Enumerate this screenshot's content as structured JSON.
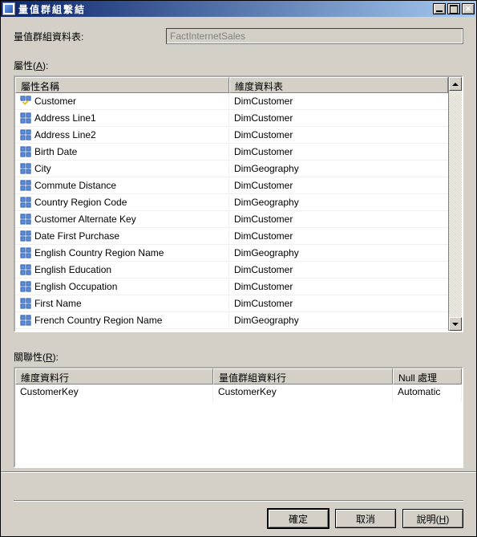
{
  "window": {
    "title": "量值群組繫結"
  },
  "measure_group": {
    "label": "量值群組資料表:",
    "value": "FactInternetSales"
  },
  "attributes": {
    "label_prefix": "屬性(",
    "label_key": "A",
    "label_suffix": "):",
    "col_name": "屬性名稱",
    "col_dim": "維度資料表",
    "rows": [
      {
        "icon": "key",
        "name": "Customer",
        "dim": "DimCustomer"
      },
      {
        "icon": "attr",
        "name": "Address Line1",
        "dim": "DimCustomer"
      },
      {
        "icon": "attr",
        "name": "Address Line2",
        "dim": "DimCustomer"
      },
      {
        "icon": "attr",
        "name": "Birth Date",
        "dim": "DimCustomer"
      },
      {
        "icon": "attr",
        "name": "City",
        "dim": "DimGeography"
      },
      {
        "icon": "attr",
        "name": "Commute Distance",
        "dim": "DimCustomer"
      },
      {
        "icon": "attr",
        "name": "Country Region Code",
        "dim": "DimGeography"
      },
      {
        "icon": "attr",
        "name": "Customer Alternate Key",
        "dim": "DimCustomer"
      },
      {
        "icon": "attr",
        "name": "Date First Purchase",
        "dim": "DimCustomer"
      },
      {
        "icon": "attr",
        "name": "English Country Region Name",
        "dim": "DimGeography"
      },
      {
        "icon": "attr",
        "name": "English Education",
        "dim": "DimCustomer"
      },
      {
        "icon": "attr",
        "name": "English Occupation",
        "dim": "DimCustomer"
      },
      {
        "icon": "attr",
        "name": "First Name",
        "dim": "DimCustomer"
      },
      {
        "icon": "attr",
        "name": "French Country Region Name",
        "dim": "DimGeography"
      }
    ]
  },
  "relationship": {
    "label_prefix": "關聯性(",
    "label_key": "R",
    "label_suffix": "):",
    "col_dim": "維度資料行",
    "col_mg": "量值群組資料行",
    "col_null": "Null 處理",
    "rows": [
      {
        "dim": "CustomerKey",
        "mg": "CustomerKey",
        "null": "Automatic"
      }
    ]
  },
  "buttons": {
    "ok": "確定",
    "cancel": "取消",
    "help_prefix": "說明(",
    "help_key": "H",
    "help_suffix": ")"
  }
}
